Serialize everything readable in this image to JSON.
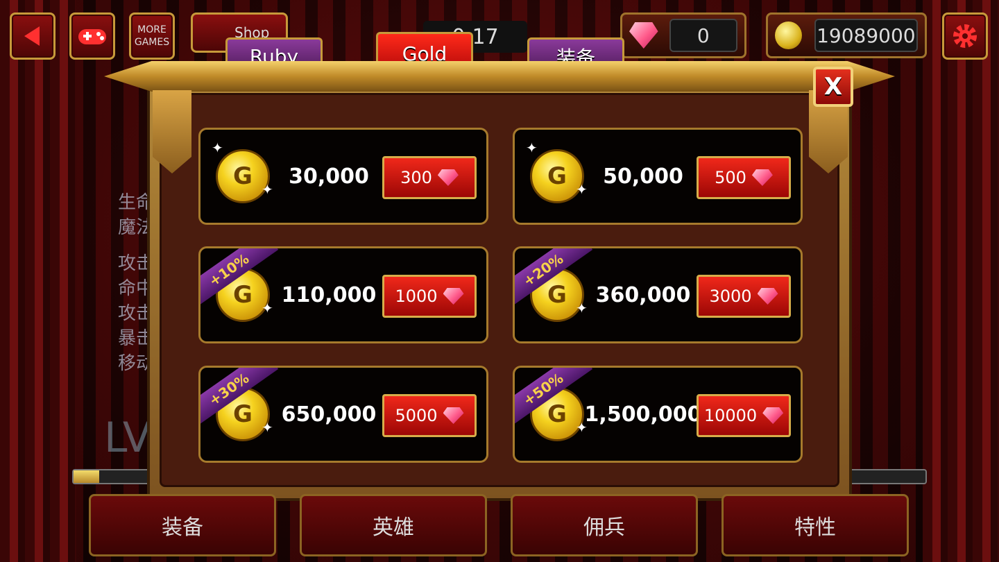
{
  "top_bar": {
    "more_games_label": "MORE\nGAMES",
    "shop_label": "Shop",
    "timer_text": "0:17",
    "ruby_amount": "0",
    "gold_amount": "19089000"
  },
  "tabs": [
    {
      "label": "Ruby",
      "active": false
    },
    {
      "label": "Gold",
      "active": true
    },
    {
      "label": "装备",
      "active": false
    }
  ],
  "close_label": "X",
  "offers": [
    {
      "amount": "30,000",
      "price": "300",
      "bonus": ""
    },
    {
      "amount": "50,000",
      "price": "500",
      "bonus": ""
    },
    {
      "amount": "110,000",
      "price": "1000",
      "bonus": "+10%"
    },
    {
      "amount": "360,000",
      "price": "3000",
      "bonus": "+20%"
    },
    {
      "amount": "650,000",
      "price": "5000",
      "bonus": "+30%"
    },
    {
      "amount": "1,500,000",
      "price": "10000",
      "bonus": "+50%"
    }
  ],
  "background": {
    "stats": [
      "生命",
      "魔法",
      "攻击",
      "命中",
      "攻击",
      "暴击",
      "移动"
    ],
    "level_prefix": "LV",
    "xp_progress": 0.03
  },
  "bottom_tabs": [
    "装备",
    "英雄",
    "佣兵",
    "特性"
  ],
  "colors": {
    "tab_active": "#e3200f",
    "tab_inactive": "#6a2a7a",
    "gold_frame": "#c79a3a",
    "price_button": "#d51a10"
  }
}
